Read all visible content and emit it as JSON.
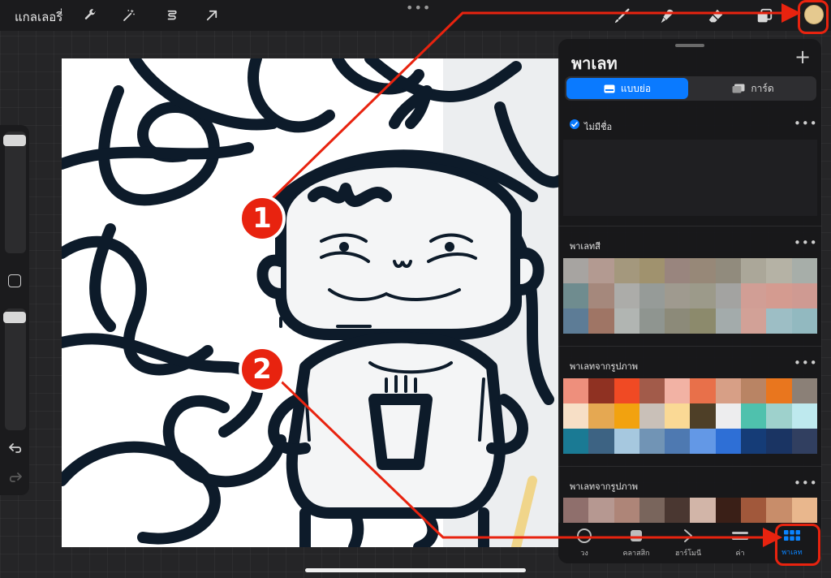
{
  "topbar": {
    "gallery_label": "แกลเลอรี่",
    "tools": [
      "wrench-icon",
      "magic-wand-icon",
      "selection-icon",
      "transform-arrow-icon"
    ],
    "right_tools": [
      "brush-icon",
      "smudge-icon",
      "eraser-icon",
      "layers-icon"
    ],
    "current_color": "#e5c98f"
  },
  "panel": {
    "title": "พาเลท",
    "add": "+",
    "seg_compact": "แบบย่อ",
    "seg_cards": "การ์ด",
    "palettes": [
      {
        "name": "ไม่มีชื่อ",
        "more": "•••",
        "default": true,
        "colors": []
      },
      {
        "name": "พาเลทสี",
        "more": "•••",
        "colors": [
          "#a7a4a1",
          "#b39a91",
          "#a4987d",
          "#a0926e",
          "#99857e",
          "#978878",
          "#918b7d",
          "#aba799",
          "#b5b2a5",
          "#a7aea9",
          "#6f8c8f",
          "#a5887c",
          "#acaca9",
          "#969b98",
          "#9f9a8f",
          "#9c9a8a",
          "#a3a3a1",
          "#d19e95",
          "#d49b90",
          "#cf9a92",
          "#5d7c96",
          "#9f7565",
          "#b1b5b2",
          "#8f9590",
          "#8c8a79",
          "#8c8a6c",
          "#a3abab",
          "#d2a197",
          "#9dbec5",
          "#92b9c0"
        ]
      },
      {
        "name": "พาเลทจากรูปภาพ",
        "more": "•••",
        "colors": [
          "#ee8f7c",
          "#8f3122",
          "#f04a24",
          "#a25b4a",
          "#f2b2a4",
          "#e8704a",
          "#d79f86",
          "#b98464",
          "#e9761e",
          "#8b8077",
          "#f7dfc6",
          "#e5a852",
          "#f2a20f",
          "#c9c0b8",
          "#fad995",
          "#4e3f27",
          "#ededee",
          "#4fc1ad",
          "#9ed1cc",
          "#bee9ee",
          "#1a7a94",
          "#3d6383",
          "#a6c8df",
          "#7194b5",
          "#4e79b1",
          "#6398e6",
          "#2e6fd6",
          "#153c77",
          "#1a3463",
          "#313f60"
        ]
      },
      {
        "name": "พาเลทจากรูปภาพ",
        "more": "•••",
        "colors": [
          "#8f6f6c",
          "#b69891",
          "#ae8578",
          "#79655c",
          "#4a3731",
          "#d2b5a8",
          "#3a1f17",
          "#a1583b",
          "#c88d6a",
          "#e9b78d"
        ]
      }
    ],
    "tabs": [
      {
        "label": "วง",
        "icon": "disc-icon"
      },
      {
        "label": "คลาสสิก",
        "icon": "classic-square-icon"
      },
      {
        "label": "ฮาร์โมนี",
        "icon": "harmony-icon"
      },
      {
        "label": "ค่า",
        "icon": "value-sliders-icon"
      },
      {
        "label": "พาเลท",
        "icon": "palette-grid-icon"
      }
    ]
  },
  "annotations": {
    "step1": "1",
    "step2": "2",
    "accent": "#e8230f"
  }
}
